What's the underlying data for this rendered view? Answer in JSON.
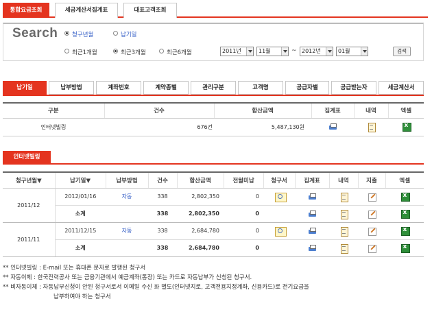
{
  "top_tabs": [
    "통합요금조회",
    "세금계산서집계표",
    "대표고객조회"
  ],
  "search": {
    "title": "Search",
    "type_options": [
      "청구년월",
      "납기일"
    ],
    "period_options": [
      "최근1개월",
      "최근3개월",
      "최근6개월"
    ],
    "from_year": "2011년",
    "from_month": "11월",
    "tilde": "~",
    "to_year": "2012년",
    "to_month": "01월",
    "button": "검색"
  },
  "sub_tabs": [
    "납기일",
    "납부방법",
    "계좌번호",
    "계약종별",
    "관리구분",
    "고객명",
    "공급자별",
    "공급받는자",
    "세금계산서"
  ],
  "summary_table": {
    "headers": [
      "구분",
      "건수",
      "합산금액",
      "집계표",
      "내역",
      "엑셀"
    ],
    "rows": [
      {
        "category": "인터넷빌링",
        "count": "676건",
        "amount": "5,487,130원"
      }
    ]
  },
  "section_label": "인터넷빌링",
  "detail_table": {
    "headers": [
      "청구년월▼",
      "납기일▼",
      "납부방법",
      "건수",
      "합산금액",
      "전월미납",
      "청구서",
      "집계표",
      "내역",
      "지출",
      "엑셀"
    ],
    "groups": [
      {
        "period": "2011/12",
        "row": {
          "due": "2012/01/16",
          "method": "자동",
          "count": "338",
          "amount": "2,802,350",
          "unpaid": "0"
        },
        "subtotal": {
          "label": "소계",
          "count": "338",
          "amount": "2,802,350",
          "unpaid": "0"
        }
      },
      {
        "period": "2011/11",
        "row": {
          "due": "2011/12/15",
          "method": "자동",
          "count": "338",
          "amount": "2,684,780",
          "unpaid": "0"
        },
        "subtotal": {
          "label": "소계",
          "count": "338",
          "amount": "2,684,780",
          "unpaid": "0"
        }
      }
    ]
  },
  "notes": [
    "** 인터넷빌링 : E-mail 또는 휴대폰 문자로 발행된 청구서",
    "** 자동이체 : 한국전력공사 또는 금융기관에서 예금계좌(통장) 또는 카드로 자동납부가 신청된 청구서.",
    "** 비자동이체 : 자동납부신청이 안된 청구서로서 이메일 수신 화 별도(인터넷지로, 고객전용지정계좌, 신용카드)로 전기요금을",
    "납부하여야 하는 청구서"
  ],
  "colors": {
    "accent": "#e4341f",
    "link": "#2d58c4"
  }
}
